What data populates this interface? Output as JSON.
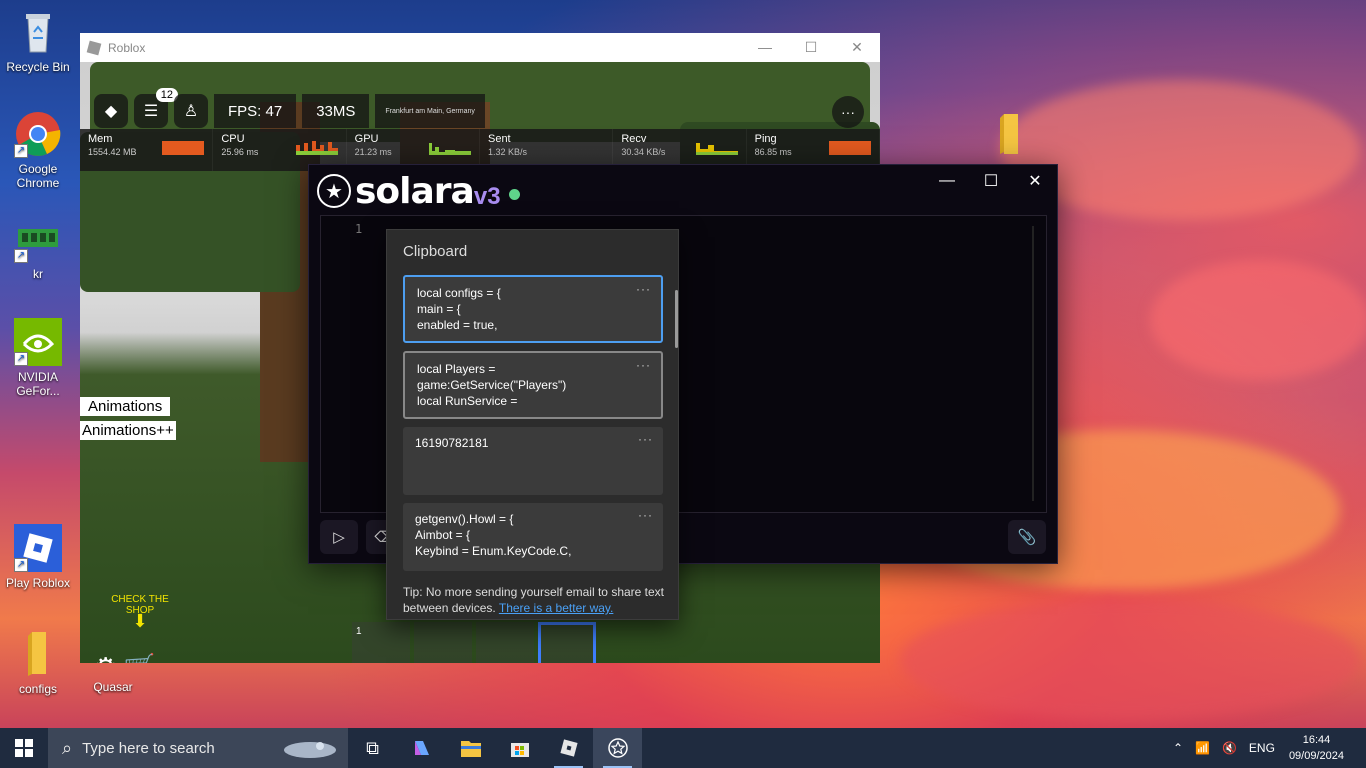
{
  "desktop": {
    "icons": [
      {
        "label": "Recycle Bin",
        "icon": "recycle-bin-icon"
      },
      {
        "label": "Google Chrome",
        "icon": "chrome-icon"
      },
      {
        "label": "kr",
        "icon": "ram-icon"
      },
      {
        "label": "NVIDIA GeFor...",
        "icon": "nvidia-icon"
      },
      {
        "label": "Play Roblox",
        "icon": "roblox-icon"
      },
      {
        "label": "configs",
        "icon": "folder-icon"
      },
      {
        "label": "Quasar",
        "icon": "quasar-icon"
      }
    ]
  },
  "roblox": {
    "title": "Roblox",
    "chat_badge": "12",
    "fps": "FPS: 47",
    "ping_ms": "33MS",
    "server_location": "Frankfurt am Main, Germany",
    "perf": [
      {
        "label": "Mem",
        "value": "1554.42 MB"
      },
      {
        "label": "CPU",
        "value": "25.96 ms"
      },
      {
        "label": "GPU",
        "value": "21.23 ms"
      },
      {
        "label": "Sent",
        "value": "1.32 KB/s"
      },
      {
        "label": "Recv",
        "value": "30.34 KB/s"
      },
      {
        "label": "Ping",
        "value": "86.85 ms"
      }
    ],
    "animations": "Animations",
    "animations_plus": "Animations++",
    "check_shop": "CHECK THE SHOP",
    "hotbar_slot_number": "1"
  },
  "solara": {
    "title": "solara",
    "version": "v3",
    "status_color": "#5fd48a",
    "line_number": "1"
  },
  "clipboard": {
    "title": "Clipboard",
    "items": [
      {
        "line1": "local configs = {",
        "line2": "main = {",
        "line3": "enabled = true,"
      },
      {
        "line1": "local Players =",
        "line2": "game:GetService(\"Players\")",
        "line3": "local RunService ="
      },
      {
        "line1": "16190782181",
        "line2": "",
        "line3": ""
      },
      {
        "line1": "getgenv().Howl = {",
        "line2": "Aimbot = {",
        "line3": "Keybind = Enum.KeyCode.C,"
      }
    ],
    "more": "···",
    "tip": "Tip: No more sending yourself email to share text between devices.",
    "tip_link": "There is a better way."
  },
  "taskbar": {
    "search_placeholder": "Type here to search",
    "language": "ENG",
    "time": "16:44",
    "date": "09/09/2024"
  }
}
